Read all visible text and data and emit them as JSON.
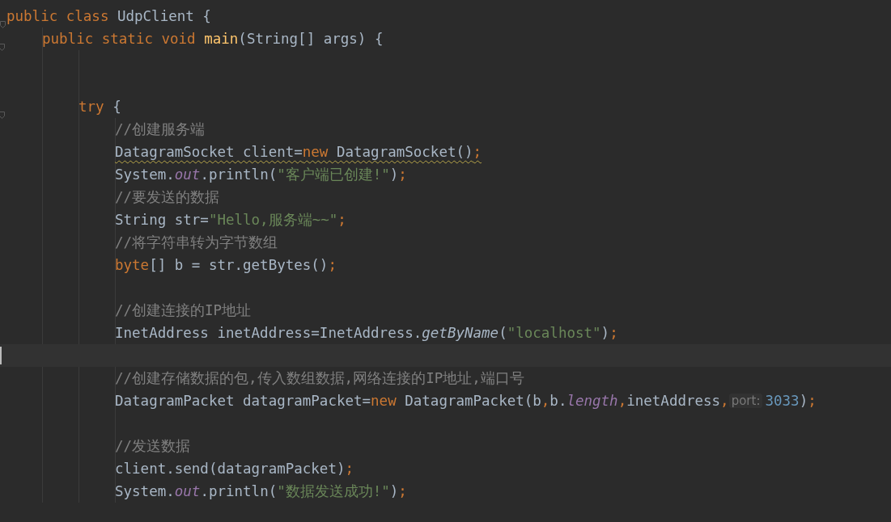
{
  "editor": {
    "lines": [
      {
        "tokens": [
          {
            "kind": "keyword",
            "text": "public class "
          },
          {
            "kind": "plain",
            "text": "UdpClient {"
          }
        ],
        "children": [
          {
            "tokens": [
              {
                "kind": "keyword",
                "text": "public static void "
              },
              {
                "kind": "method",
                "text": "main"
              },
              {
                "kind": "plain",
                "text": "(String[] args) {"
              }
            ],
            "children": [
              {
                "kind": "blank"
              },
              {
                "kind": "blank"
              },
              {
                "tokens": [
                  {
                    "kind": "keyword",
                    "text": "try "
                  },
                  {
                    "kind": "plain",
                    "text": "{"
                  }
                ],
                "children": [
                  {
                    "tokens": [
                      {
                        "kind": "comment",
                        "text": "//创建服务端"
                      }
                    ]
                  },
                  {
                    "warning": true,
                    "tokens": [
                      {
                        "kind": "plain",
                        "text": "DatagramSocket client="
                      },
                      {
                        "kind": "keyword",
                        "text": "new "
                      },
                      {
                        "kind": "plain",
                        "text": "DatagramSocket()"
                      },
                      {
                        "kind": "keyword",
                        "text": ";"
                      }
                    ]
                  },
                  {
                    "tokens": [
                      {
                        "kind": "plain",
                        "text": "System."
                      },
                      {
                        "kind": "field",
                        "text": "out"
                      },
                      {
                        "kind": "plain",
                        "text": ".println("
                      },
                      {
                        "kind": "string",
                        "text": "\"客户端已创建!\""
                      },
                      {
                        "kind": "plain",
                        "text": ")"
                      },
                      {
                        "kind": "keyword",
                        "text": ";"
                      }
                    ]
                  },
                  {
                    "tokens": [
                      {
                        "kind": "comment",
                        "text": "//要发送的数据"
                      }
                    ]
                  },
                  {
                    "tokens": [
                      {
                        "kind": "plain",
                        "text": "String str="
                      },
                      {
                        "kind": "string",
                        "text": "\"Hello,服务端~~\""
                      },
                      {
                        "kind": "keyword",
                        "text": ";"
                      }
                    ]
                  },
                  {
                    "tokens": [
                      {
                        "kind": "comment",
                        "text": "//将字符串转为字节数组"
                      }
                    ]
                  },
                  {
                    "tokens": [
                      {
                        "kind": "keyword",
                        "text": "byte"
                      },
                      {
                        "kind": "plain",
                        "text": "[] b = str.getBytes()"
                      },
                      {
                        "kind": "keyword",
                        "text": ";"
                      }
                    ]
                  },
                  {
                    "kind": "blank"
                  },
                  {
                    "tokens": [
                      {
                        "kind": "comment",
                        "text": "//创建连接的IP地址"
                      }
                    ]
                  },
                  {
                    "tokens": [
                      {
                        "kind": "plain",
                        "text": "InetAddress inetAddress=InetAddress."
                      },
                      {
                        "kind": "static",
                        "text": "getByName"
                      },
                      {
                        "kind": "plain",
                        "text": "("
                      },
                      {
                        "kind": "string",
                        "text": "\"localhost\""
                      },
                      {
                        "kind": "plain",
                        "text": ")"
                      },
                      {
                        "kind": "keyword",
                        "text": ";"
                      }
                    ]
                  },
                  {
                    "kind": "blank",
                    "current": true
                  },
                  {
                    "tokens": [
                      {
                        "kind": "comment",
                        "text": "//创建存储数据的包,传入数组数据,网络连接的IP地址,端口号"
                      }
                    ]
                  },
                  {
                    "tokens": [
                      {
                        "kind": "plain",
                        "text": "DatagramPacket datagramPacket="
                      },
                      {
                        "kind": "keyword",
                        "text": "new "
                      },
                      {
                        "kind": "plain",
                        "text": "DatagramPacket(b"
                      },
                      {
                        "kind": "keyword",
                        "text": ","
                      },
                      {
                        "kind": "plain",
                        "text": "b."
                      },
                      {
                        "kind": "field",
                        "text": "length"
                      },
                      {
                        "kind": "keyword",
                        "text": ","
                      },
                      {
                        "kind": "plain",
                        "text": "inetAddress"
                      },
                      {
                        "kind": "keyword",
                        "text": ","
                      },
                      {
                        "kind": "hint",
                        "text": "port:"
                      },
                      {
                        "kind": "number",
                        "text": "3033"
                      },
                      {
                        "kind": "plain",
                        "text": ")"
                      },
                      {
                        "kind": "keyword",
                        "text": ";"
                      }
                    ]
                  },
                  {
                    "kind": "blank"
                  },
                  {
                    "tokens": [
                      {
                        "kind": "comment",
                        "text": "//发送数据"
                      }
                    ]
                  },
                  {
                    "tokens": [
                      {
                        "kind": "plain",
                        "text": "client.send(datagramPacket)"
                      },
                      {
                        "kind": "keyword",
                        "text": ";"
                      }
                    ]
                  },
                  {
                    "tokens": [
                      {
                        "kind": "plain",
                        "text": "System."
                      },
                      {
                        "kind": "field",
                        "text": "out"
                      },
                      {
                        "kind": "plain",
                        "text": ".println("
                      },
                      {
                        "kind": "string",
                        "text": "\"数据发送成功!\""
                      },
                      {
                        "kind": "plain",
                        "text": ")"
                      },
                      {
                        "kind": "keyword",
                        "text": ";"
                      }
                    ]
                  }
                ]
              }
            ]
          }
        ]
      }
    ]
  }
}
